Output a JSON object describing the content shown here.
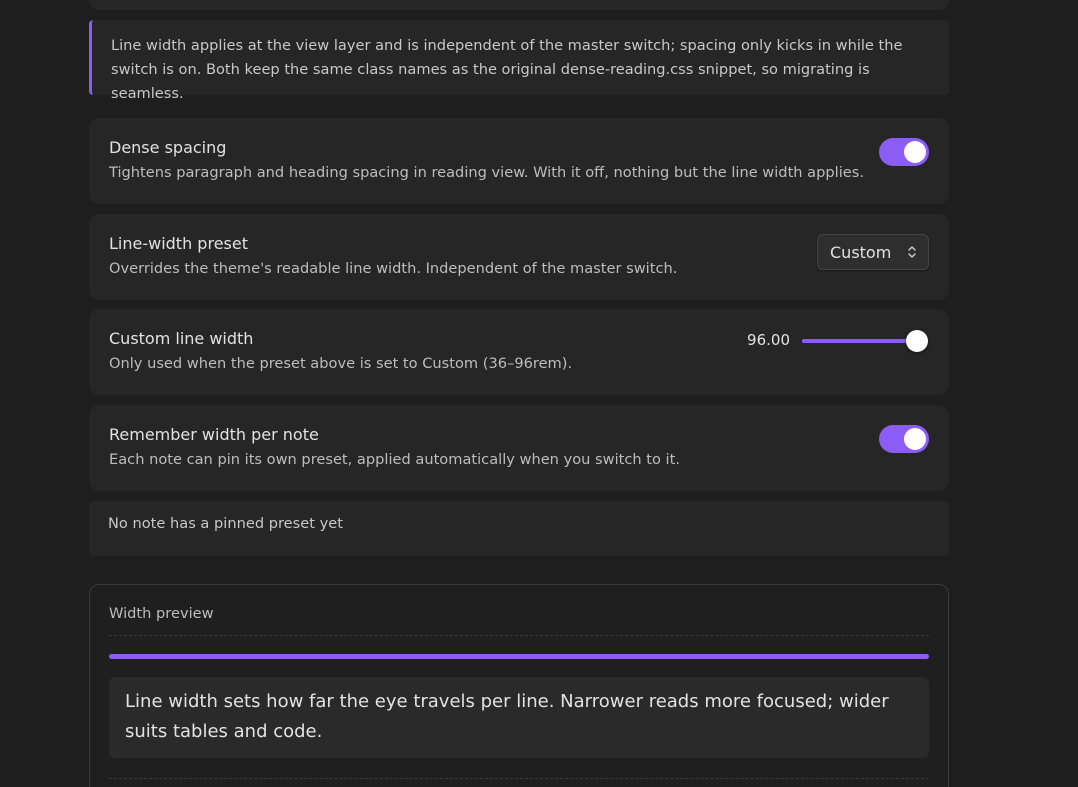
{
  "callout": {
    "text": "Line width applies at the view layer and is independent of the master switch; spacing only kicks in while the switch is on. Both keep the same class names as the original dense-reading.css snippet, so migrating is seamless."
  },
  "settings": {
    "dense_spacing": {
      "name": "Dense spacing",
      "desc": "Tightens paragraph and heading spacing in reading view. With it off, nothing but the line width applies.",
      "enabled": true
    },
    "line_width_preset": {
      "name": "Line-width preset",
      "desc": "Overrides the theme's readable line width. Independent of the master switch.",
      "selected": "Custom"
    },
    "custom_line_width": {
      "name": "Custom line width",
      "desc": "Only used when the preset above is set to Custom (36–96rem).",
      "value_label": "96.00",
      "value": 96,
      "min": 36,
      "max": 96
    },
    "remember_width": {
      "name": "Remember width per note",
      "desc": "Each note can pin its own preset, applied automatically when you switch to it.",
      "enabled": true
    }
  },
  "pinned_notes": {
    "empty_text": "No note has a pinned preset yet"
  },
  "preview": {
    "title": "Width preview",
    "width_fraction": 1.0,
    "sample_text": "Line width sets how far the eye travels per line. Narrower reads more focused; wider suits tables and code."
  },
  "colors": {
    "accent": "#8b5cf6",
    "background": "#1e1e1e",
    "card": "#262626"
  },
  "icons": {
    "dropdown": "chevron-up-down-icon"
  }
}
